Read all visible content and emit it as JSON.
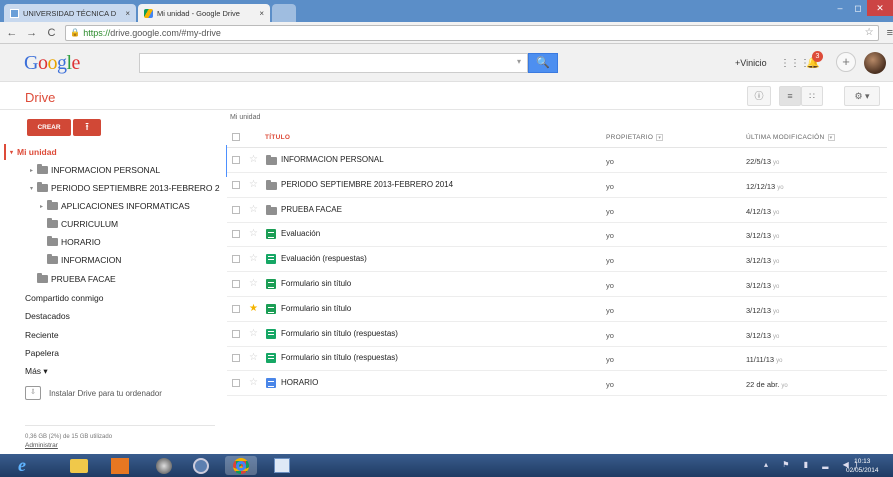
{
  "browser": {
    "tabs": [
      {
        "title": "UNIVERSIDAD TÉCNICA D",
        "close": "×"
      },
      {
        "title": "Mi unidad - Google Drive",
        "close": "×"
      }
    ],
    "url_https": "https://",
    "url_rest": "drive.google.com/#my-drive"
  },
  "google_bar": {
    "logo": [
      "G",
      "o",
      "o",
      "g",
      "l",
      "e"
    ],
    "user": "+Vinicio",
    "notifications": "3"
  },
  "drive": {
    "title": "Drive",
    "create_label": "CREAR",
    "breadcrumb": "Mi unidad"
  },
  "sidebar": {
    "mi_unidad": "Mi unidad",
    "tree": [
      "INFORMACION PERSONAL",
      "PERIODO SEPTIEMBRE 2013-FEBRERO 2",
      "APLICACIONES INFORMATICAS",
      "CURRICULUM",
      "HORARIO",
      "INFORMACION",
      "PRUEBA FACAE"
    ],
    "links": [
      "Compartido conmigo",
      "Destacados",
      "Reciente",
      "Papelera",
      "Más ▾"
    ],
    "install": "Instalar Drive para tu ordenador",
    "storage": "0,36 GB (2%) de 15 GB utilizado",
    "admin": "Administrar"
  },
  "table": {
    "headers": {
      "title": "TÍTULO",
      "owner": "PROPIETARIO",
      "modified": "ÚLTIMA MODIFICACIÓN"
    },
    "rows": [
      {
        "name": "INFORMACION PERSONAL",
        "type": "folder",
        "starred": false,
        "owner": "yo",
        "modified": "22/5/13",
        "by": "yo"
      },
      {
        "name": "PERIODO SEPTIEMBRE 2013-FEBRERO 2014",
        "type": "folder",
        "starred": false,
        "owner": "yo",
        "modified": "12/12/13",
        "by": "yo"
      },
      {
        "name": "PRUEBA FACAE",
        "type": "folder",
        "starred": false,
        "owner": "yo",
        "modified": "4/12/13",
        "by": "yo"
      },
      {
        "name": "Evaluación",
        "type": "form",
        "starred": false,
        "owner": "yo",
        "modified": "3/12/13",
        "by": "yo"
      },
      {
        "name": "Evaluación (respuestas)",
        "type": "sheet",
        "starred": false,
        "owner": "yo",
        "modified": "3/12/13",
        "by": "yo"
      },
      {
        "name": "Formulario sin título",
        "type": "form",
        "starred": false,
        "owner": "yo",
        "modified": "3/12/13",
        "by": "yo"
      },
      {
        "name": "Formulario sin título",
        "type": "form",
        "starred": true,
        "owner": "yo",
        "modified": "3/12/13",
        "by": "yo"
      },
      {
        "name": "Formulario sin título (respuestas)",
        "type": "sheet",
        "starred": false,
        "owner": "yo",
        "modified": "3/12/13",
        "by": "yo"
      },
      {
        "name": "Formulario sin título (respuestas)",
        "type": "sheet",
        "starred": false,
        "owner": "yo",
        "modified": "11/11/13",
        "by": "yo"
      },
      {
        "name": "HORARIO",
        "type": "doc",
        "starred": false,
        "owner": "yo",
        "modified": "22 de abr.",
        "by": "yo"
      }
    ]
  },
  "taskbar": {
    "time": "10:13",
    "date": "02/05/2014",
    "ie_glyph": "e"
  }
}
